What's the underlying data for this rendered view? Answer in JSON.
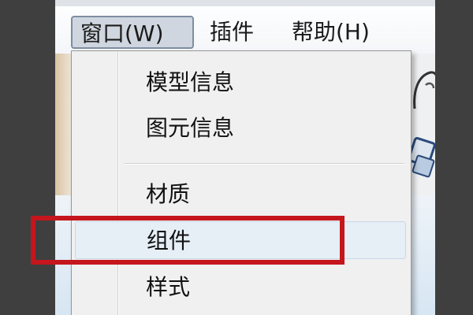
{
  "menubar": {
    "items": [
      {
        "label": "窗口(W)",
        "state": "open"
      },
      {
        "label": "插件"
      },
      {
        "label": "帮助(H)"
      }
    ]
  },
  "dropdown": {
    "items": [
      {
        "label": "模型信息"
      },
      {
        "label": "图元信息"
      },
      {
        "label": "材质"
      },
      {
        "label": "组件",
        "highlighted": true
      },
      {
        "label": "样式"
      }
    ]
  },
  "colors": {
    "highlight_border": "#c4161c",
    "menu_background": "#f0f0f0",
    "active_menu_background": "#cfd6df"
  },
  "icons": [
    "sketchup-tool-icon",
    "sketchup-orbit-icon"
  ]
}
